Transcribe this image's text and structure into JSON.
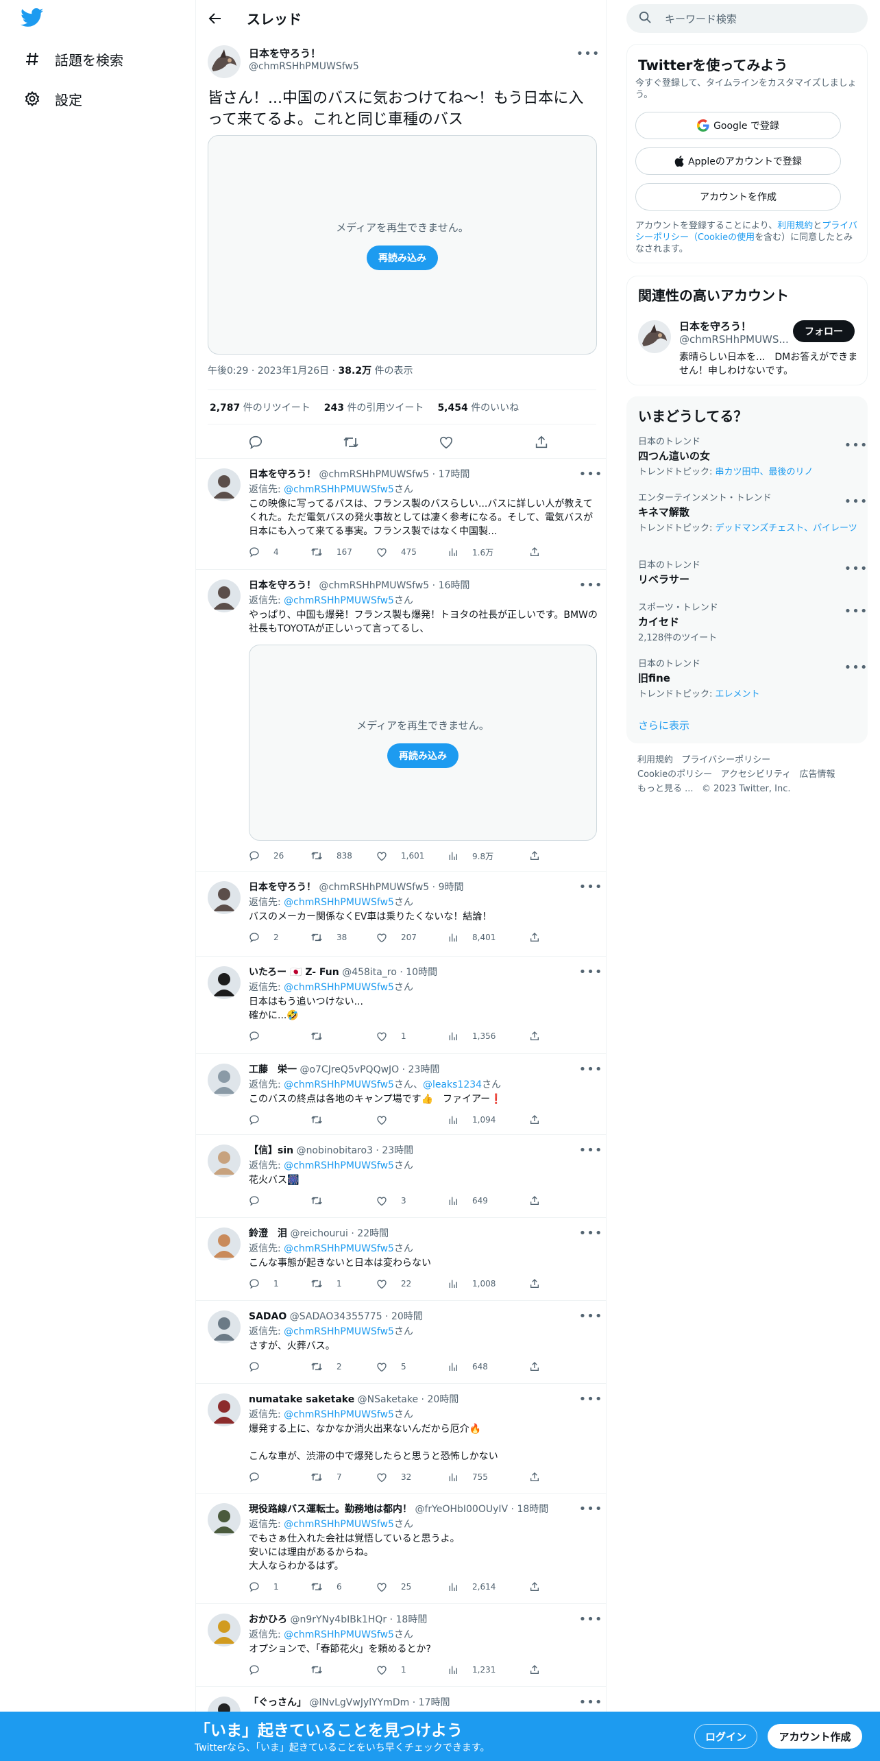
{
  "nav": {
    "explore": "話題を検索",
    "settings": "設定"
  },
  "header": {
    "title": "スレッド"
  },
  "main_tweet": {
    "name": "日本を守ろう！",
    "handle": "@chmRSHhPMUWSfw5",
    "text": "皆さん！...中国のバスに気おつけてね〜！もう日本に入って来てるよ。これと同じ車種のバス",
    "media_message": "メディアを再生できません。",
    "reload": "再読み込み",
    "time": "午後0:29",
    "date": "2023年1月26日",
    "views_count": "38.2万",
    "views_label": "件の表示",
    "retweets_count": "2,787",
    "retweets_label": "件のリツイート",
    "quotes_count": "243",
    "quotes_label": "件の引用ツイート",
    "likes_count": "5,454",
    "likes_label": "件のいいね"
  },
  "reply_to_label": "返信先:",
  "reply_suffix": "さん",
  "replies": [
    {
      "name": "日本を守ろう！",
      "handle": "@chmRSHhPMUWSfw5",
      "time": "17時間",
      "to": "@chmRSHhPMUWSfw5",
      "text": "この映像に写ってるバスは、フランス製のバスらしい...バスに詳しい人が教えてくれた。ただ電気バスの発火事故としては凄く参考になる。そして、電気バスが日本にも入って来てる事実。フランス製ではなく中国製...",
      "replies": "4",
      "retweets": "167",
      "likes": "475",
      "views": "1.6万"
    },
    {
      "name": "日本を守ろう！",
      "handle": "@chmRSHhPMUWSfw5",
      "time": "16時間",
      "to": "@chmRSHhPMUWSfw5",
      "text": "やっぱり、中国も爆発！フランス製も爆発！トヨタの社長が正しいです。BMWの社長もTOYOTAが正しいって言ってるし、",
      "media_message": "メディアを再生できません。",
      "reload": "再読み込み",
      "replies": "26",
      "retweets": "838",
      "likes": "1,601",
      "views": "9.8万"
    },
    {
      "name": "日本を守ろう！",
      "handle": "@chmRSHhPMUWSfw5",
      "time": "9時間",
      "to": "@chmRSHhPMUWSfw5",
      "text": "バスのメーカー関係なくEV車は乗りたくないな！結論！",
      "replies": "2",
      "retweets": "38",
      "likes": "207",
      "views": "8,401"
    },
    {
      "name": "いたろー 🇯🇵 Z- Fun",
      "handle": "@458ita_ro",
      "time": "10時間",
      "to": "@chmRSHhPMUWSfw5",
      "text": "日本はもう追いつけない...\n確かに...🤣",
      "replies": "",
      "retweets": "",
      "likes": "1",
      "views": "1,356"
    },
    {
      "name": "工藤　栄一",
      "handle": "@o7CJreQ5vPQQwJO",
      "time": "23時間",
      "to": "@chmRSHhPMUWSfw5",
      "to2": "@leaks1234",
      "text": "このバスの終点は各地のキャンプ場です👍　ファイアー❗",
      "replies": "",
      "retweets": "",
      "likes": "",
      "views": "1,094"
    },
    {
      "name": "【信】sin",
      "handle": "@nobinobitaro3",
      "time": "23時間",
      "to": "@chmRSHhPMUWSfw5",
      "text": "花火バス🎆",
      "replies": "",
      "retweets": "",
      "likes": "3",
      "views": "649"
    },
    {
      "name": "鈴澄　泪",
      "handle": "@reichourui",
      "time": "22時間",
      "to": "@chmRSHhPMUWSfw5",
      "text": "こんな事態が起きないと日本は変わらない",
      "replies": "1",
      "retweets": "1",
      "likes": "22",
      "views": "1,008"
    },
    {
      "name": "SADAO",
      "handle": "@SADAO34355775",
      "time": "20時間",
      "to": "@chmRSHhPMUWSfw5",
      "text": "さすが、火葬バス。",
      "replies": "",
      "retweets": "2",
      "likes": "5",
      "views": "648"
    },
    {
      "name": "numatake saketake",
      "handle": "@NSaketake",
      "time": "20時間",
      "to": "@chmRSHhPMUWSfw5",
      "text": "爆発する上に、なかなか消火出来ないんだから厄介🔥\n\nこんな車が、渋滞の中で爆発したらと思うと恐怖しかない",
      "replies": "",
      "retweets": "7",
      "likes": "32",
      "views": "755"
    },
    {
      "name": "現役路線バス運転士。勤務地は都内！",
      "handle": "@frYeOHbI00OUyIV",
      "time": "18時間",
      "to": "@chmRSHhPMUWSfw5",
      "text": "でもさぁ仕入れた会社は覚悟していると思うよ。\n安いには理由があるからね。\n大人ならわかるはず。",
      "replies": "1",
      "retweets": "6",
      "likes": "25",
      "views": "2,614"
    },
    {
      "name": "おかひろ",
      "handle": "@n9rYNy4bIBk1HQr",
      "time": "18時間",
      "to": "@chmRSHhPMUWSfw5",
      "text": "オプションで、「春節花火」を頼めるとか?",
      "replies": "",
      "retweets": "",
      "likes": "1",
      "views": "1,231"
    },
    {
      "name": "「ぐっさん」",
      "handle": "@lNvLgVwJylYYmDm",
      "time": "17時間",
      "to": "",
      "text": "",
      "replies": "",
      "retweets": "",
      "likes": "",
      "views": ""
    }
  ],
  "sidebar": {
    "search_placeholder": "キーワード検索",
    "signup_title": "Twitterを使ってみよう",
    "signup_sub": "今すぐ登録して、タイムラインをカスタマイズしましょう。",
    "google_btn": "Google で登録",
    "apple_btn": "Appleのアカウントで登録",
    "create_btn": "アカウントを作成",
    "terms_1": "アカウントを登録することにより、",
    "terms_link1": "利用規約",
    "terms_2": "と",
    "terms_link2": "プライバシーポリシー（Cookieの使用",
    "terms_3": "を含む）に同意したとみなされます。",
    "relevant_title": "関連性の高いアカウント",
    "rel_name": "日本を守ろう！",
    "rel_handle": "@chmRSHhPMUWS...",
    "follow": "フォロー",
    "rel_bio": "素晴らしい日本を...　DMお答えができません！申しわけないです。",
    "trends_title": "いまどうしてる？",
    "trends": [
      {
        "ctx": "日本のトレンド",
        "title": "四つん這いの女",
        "sub_label": "トレンドトピック: ",
        "sub_link": "串カツ田中、最後のリノ"
      },
      {
        "ctx": "エンターテインメント・トレンド",
        "title": "キネマ解散",
        "sub_label": "トレンドトピック: ",
        "sub_link": "デッドマンズチェスト、パイレーツ"
      },
      {
        "ctx": "日本のトレンド",
        "title": "リベラサー",
        "sub_label": "",
        "sub_link": ""
      },
      {
        "ctx": "スポーツ・トレンド",
        "title": "カイセド",
        "sub_label": "2,128件のツイート",
        "sub_link": ""
      },
      {
        "ctx": "日本のトレンド",
        "title": "旧fine",
        "sub_label": "トレンドトピック: ",
        "sub_link": "エレメント"
      }
    ],
    "show_more": "さらに表示",
    "footer": {
      "terms": "利用規約",
      "privacy": "プライバシーポリシー",
      "cookie": "Cookieのポリシー",
      "accessibility": "アクセシビリティ",
      "ads": "広告情報",
      "more": "もっと見る ...",
      "copyright": "© 2023 Twitter, Inc."
    }
  },
  "bottom_bar": {
    "title": "「いま」起きていることを見つけよう",
    "sub": "Twitterなら、「いま」起きていることをいち早くチェックできます。",
    "login": "ログイン",
    "signup": "アカウント作成"
  },
  "colors": {
    "accent": "#1d9bf0",
    "text": "#0f1419",
    "muted": "#536471"
  }
}
